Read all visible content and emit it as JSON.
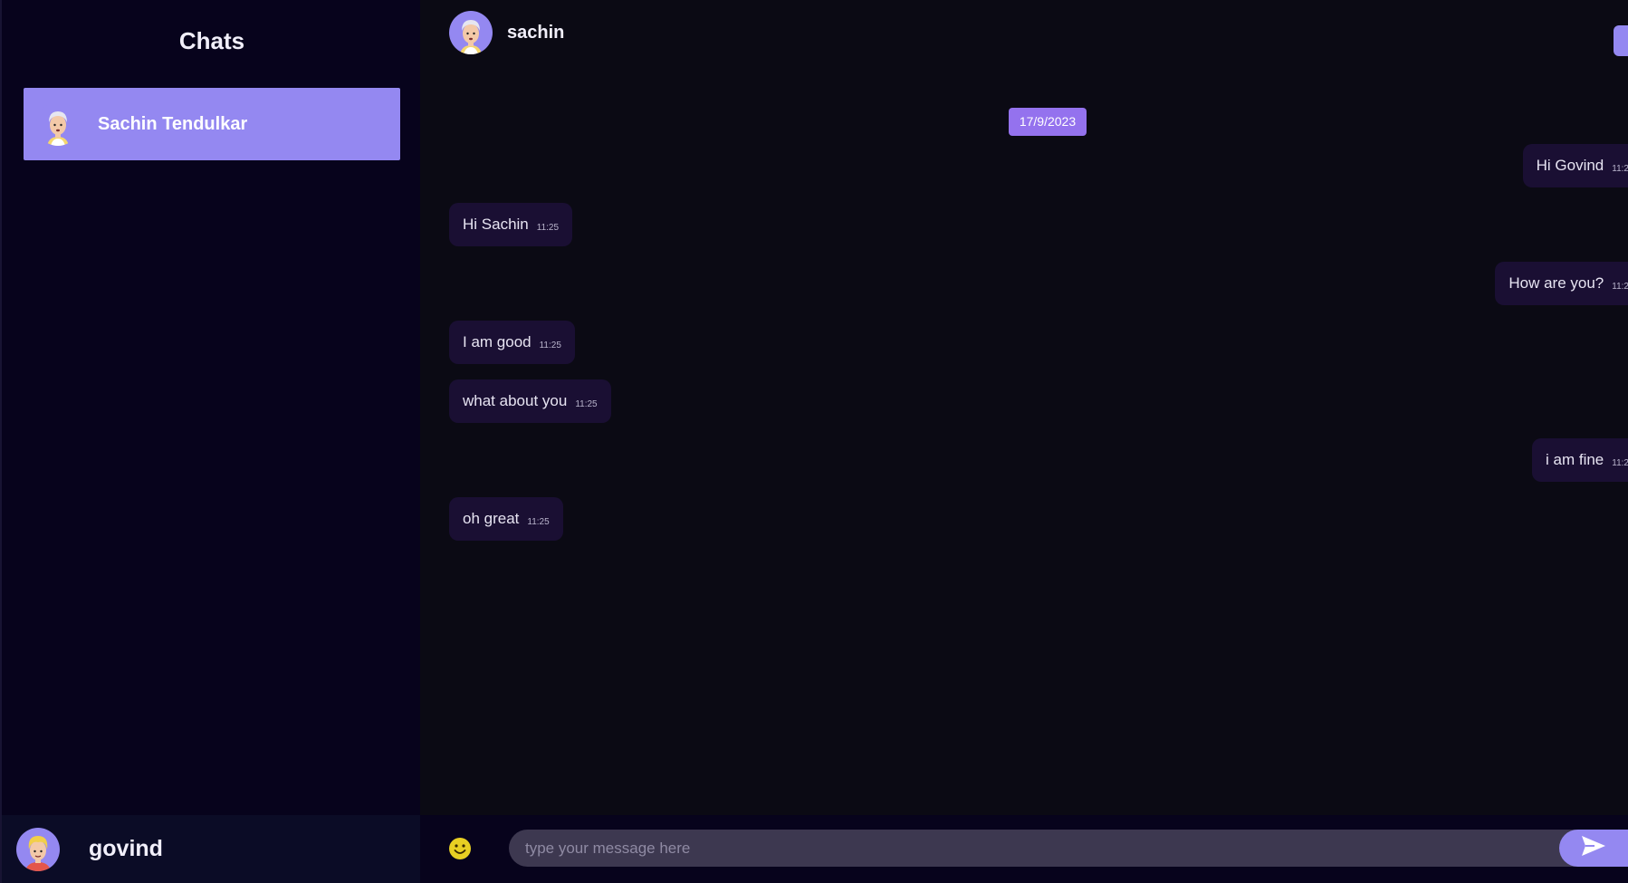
{
  "sidebar": {
    "title": "Chats",
    "chats": [
      {
        "name": "Sachin Tendulkar",
        "avatar_icon": "old-man-avatar-icon"
      }
    ],
    "footer": {
      "name": "govind",
      "avatar_icon": "blond-boy-avatar-icon"
    }
  },
  "header": {
    "name": "sachin",
    "avatar_icon": "old-man-avatar-icon"
  },
  "date_separator": "17/9/2023",
  "messages": [
    {
      "direction": "out",
      "text": "Hi Govind",
      "time": "11:2"
    },
    {
      "direction": "in",
      "text": "Hi Sachin",
      "time": "11:25"
    },
    {
      "direction": "out",
      "text": "How are you?",
      "time": "11:2"
    },
    {
      "direction": "in",
      "text": "I am good",
      "time": "11:25"
    },
    {
      "direction": "in",
      "text": "what about you",
      "time": "11:25"
    },
    {
      "direction": "out",
      "text": "i am fine",
      "time": "11:2"
    },
    {
      "direction": "in",
      "text": "oh great",
      "time": "11:25"
    }
  ],
  "composer": {
    "placeholder": "type your message here",
    "emoji_icon": "smiley-icon",
    "send_icon": "send-arrow-icon"
  },
  "colors": {
    "accent": "#9488f1",
    "sidebar_bg": "#07031c",
    "main_bg": "#0b0a14",
    "bubble_bg": "#1a0f33",
    "input_bg": "#3d3850"
  }
}
